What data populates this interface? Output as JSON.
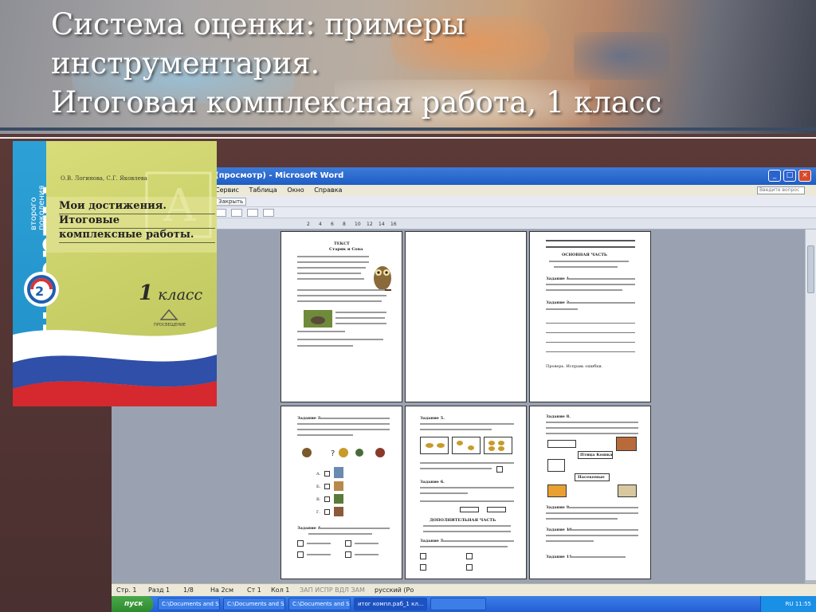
{
  "slide": {
    "title_lines": [
      "Система оценки: примеры",
      "инструментария.",
      "Итоговая комплексная работа, 1 класс"
    ]
  },
  "book": {
    "series_main": "стандарты",
    "series_sub_1": "второго",
    "series_sub_2": "поколения",
    "authors": "О.В. Логинова, С.Г. Яковлева",
    "title_lines": [
      "Мои достижения.",
      "Итоговые",
      "комплексные работы."
    ],
    "grade_number": "1",
    "grade_word": "класс",
    "publisher": "ПРОСВЕЩЕНИЕ"
  },
  "word": {
    "window_title": "(просмотр) - Microsoft Word",
    "menu": [
      "Сервис",
      "Таблица",
      "Окно",
      "Справка"
    ],
    "help_placeholder": "Введите вопрос",
    "close_button": "Закрыть",
    "ruler_ticks": [
      "2",
      "4",
      "6",
      "8",
      "10",
      "12",
      "14",
      "16"
    ],
    "status": {
      "page": "Стр. 1",
      "section": "Разд 1",
      "pages": "1/8",
      "at": "На 2см",
      "line": "Ст 1",
      "col": "Кол 1",
      "modes": "ЗАП  ИСПР  ВДЛ  ЗАМ",
      "language": "русский (Ро"
    },
    "taskbar": {
      "start": "пуск",
      "tasks": [
        "C:\\Documents and Se...",
        "C:\\Documents and Se...",
        "C:\\Documents and Se...",
        "итог компл.раб_1 кл...",
        ""
      ],
      "tray_lang": "RU",
      "clock": "11:55"
    },
    "pages": {
      "p1": {
        "heading": "ТЕКСТ",
        "subheading": "Старик и Сова"
      },
      "p3": {
        "heading": "ОСНОВНАЯ ЧАСТЬ",
        "task1": "Задание 1.",
        "task2": "Задание 2.",
        "footer": "Проверь. Исправь ошибки."
      },
      "p4": {
        "task3": "Задание 3.",
        "task4": "Задание 4.",
        "opt_a": "А.",
        "opt_b": "Б.",
        "opt_v": "В.",
        "opt_g": "Г."
      },
      "p5": {
        "task5": "Задание 5.",
        "task6": "Задание 6.",
        "extra": "ДОПОЛНИТЕЛЬНАЯ ЧАСТЬ",
        "task7": "Задание 7."
      },
      "p6": {
        "task8": "Задание 8.",
        "box1": "Птица Кошка",
        "box2": "Насекомые",
        "task9": "Задание 9.",
        "task10": "Задание 10.",
        "task11": "Задание 11."
      }
    }
  }
}
